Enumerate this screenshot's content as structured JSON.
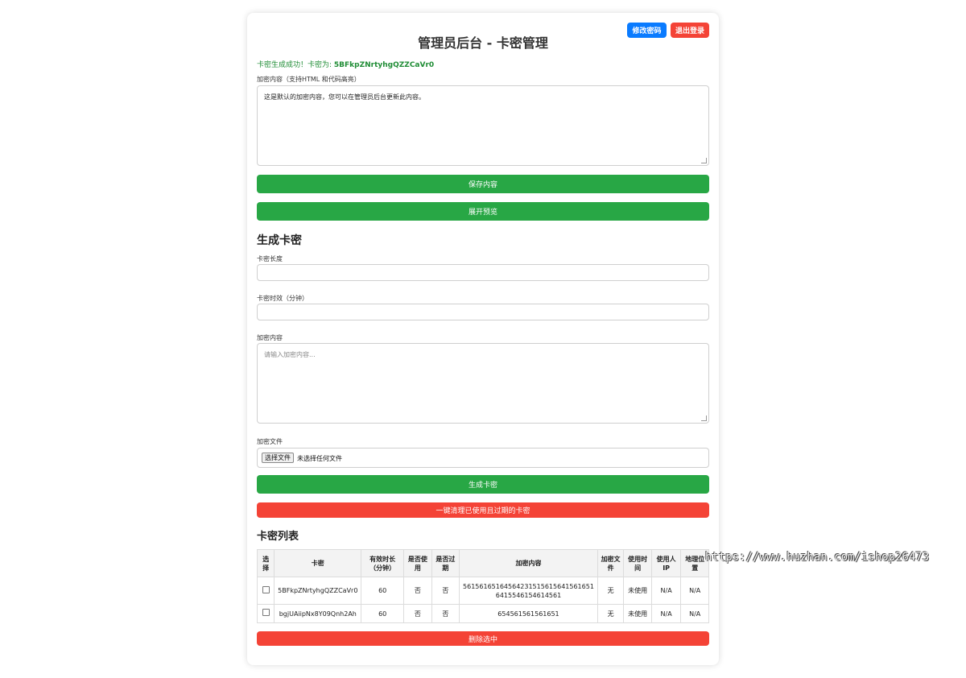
{
  "header": {
    "title": "管理员后台 - 卡密管理",
    "change_password": "修改密码",
    "logout": "退出登录"
  },
  "success": {
    "prefix": "卡密生成成功！卡密为: ",
    "code": "5BFkpZNrtyhgQZZCaVr0"
  },
  "content_editor": {
    "label": "加密内容（支持HTML 和代码高亮）",
    "value": "这是默认的加密内容，您可以在管理员后台更新此内容。",
    "save_button": "保存内容",
    "preview_button": "展开预览"
  },
  "generate": {
    "heading": "生成卡密",
    "length_label": "卡密长度",
    "length_value": "",
    "duration_label": "卡密时效（分钟）",
    "duration_value": "",
    "content_label": "加密内容",
    "content_placeholder": "请输入加密内容...",
    "file_label": "加密文件",
    "file_button": "选择文件",
    "file_status": "未选择任何文件",
    "generate_button": "生成卡密",
    "cleanup_button": "一键清理已使用且过期的卡密"
  },
  "list": {
    "heading": "卡密列表",
    "columns": [
      "选择",
      "卡密",
      "有效时长（分钟）",
      "是否使用",
      "是否过期",
      "加密内容",
      "加密文件",
      "使用时间",
      "使用人 IP",
      "地理位置"
    ],
    "rows": [
      {
        "code": "5BFkpZNrtyhgQZZCaVr0",
        "duration": "60",
        "used": "否",
        "expired": "否",
        "content": "561561651645642315156156415616516415546154614561",
        "file": "无",
        "use_time": "未使用",
        "ip": "N/A",
        "location": "N/A"
      },
      {
        "code": "bgjUAiipNx8Y09Qnh2Ah",
        "duration": "60",
        "used": "否",
        "expired": "否",
        "content": "654561561561651",
        "file": "无",
        "use_time": "未使用",
        "ip": "N/A",
        "location": "N/A"
      }
    ],
    "delete_button": "删除选中"
  },
  "watermark": "https://www.huzhan.com/ishop26473",
  "colors": {
    "blue": "#0a7bff",
    "red": "#f44336",
    "green": "#28a745",
    "success_text": "#1e8c34"
  }
}
